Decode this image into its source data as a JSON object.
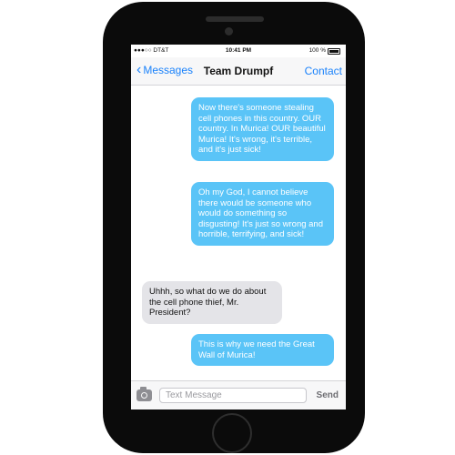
{
  "status_bar": {
    "carrier": "●●●○○ DT&T",
    "time": "10:41 PM",
    "battery": "100 %"
  },
  "nav": {
    "back_label": "Messages",
    "title": "Team Drumpf",
    "contact_label": "Contact"
  },
  "messages": [
    {
      "direction": "outgoing",
      "text": "Now there's someone stealing cell phones in this country. OUR country. In Murica! OUR beautiful Murica! It's wrong, it's terrible, and it's just sick!"
    },
    {
      "direction": "outgoing",
      "text": "Oh my God, I cannot believe there would be someone who would do something so disgusting! It's just so wrong and horrible, terrifying, and sick!"
    },
    {
      "direction": "incoming",
      "text": "Uhhh, so what do we do about the cell phone thief, Mr. President?"
    },
    {
      "direction": "outgoing",
      "text": "This is why we need the Great Wall of Murica!"
    }
  ],
  "input": {
    "placeholder": "Text Message",
    "send_label": "Send"
  },
  "colors": {
    "outgoing_bubble": "#5ac4f7",
    "incoming_bubble": "#e4e4e8",
    "accent": "#1a82fb",
    "phone_body": "#0b0b0b"
  },
  "icons": [
    "chevron-left-icon",
    "camera-icon",
    "wifi-icon",
    "battery-icon"
  ]
}
